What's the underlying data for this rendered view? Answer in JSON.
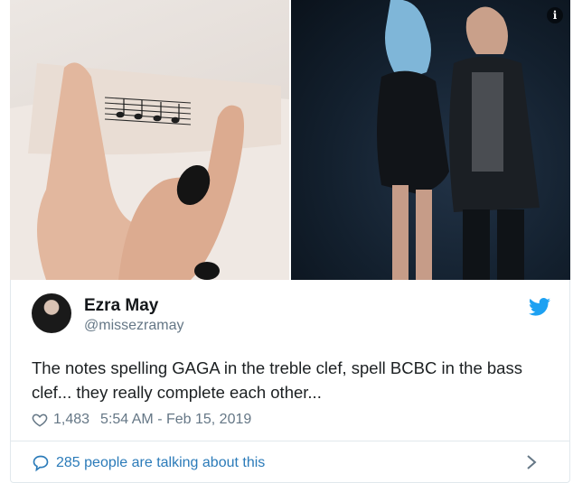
{
  "media": {
    "info_icon": "info-icon",
    "left_photo_alt": "Hand with musical notes tattoo",
    "right_photo_alt": "Two people on stage"
  },
  "author": {
    "name": "Ezra May",
    "handle": "@missezramay"
  },
  "tweet": {
    "text": "The notes spelling GAGA in the treble clef, spell BCBC in the bass clef... they really complete each other...",
    "likes": "1,483",
    "timestamp": "5:54 AM - Feb 15, 2019"
  },
  "footer": {
    "talking": "285 people are talking about this"
  },
  "colors": {
    "twitter_blue": "#1da1f2",
    "link_blue": "#2b7bb9",
    "meta_gray": "#657786",
    "text_dark": "#1c2022"
  }
}
